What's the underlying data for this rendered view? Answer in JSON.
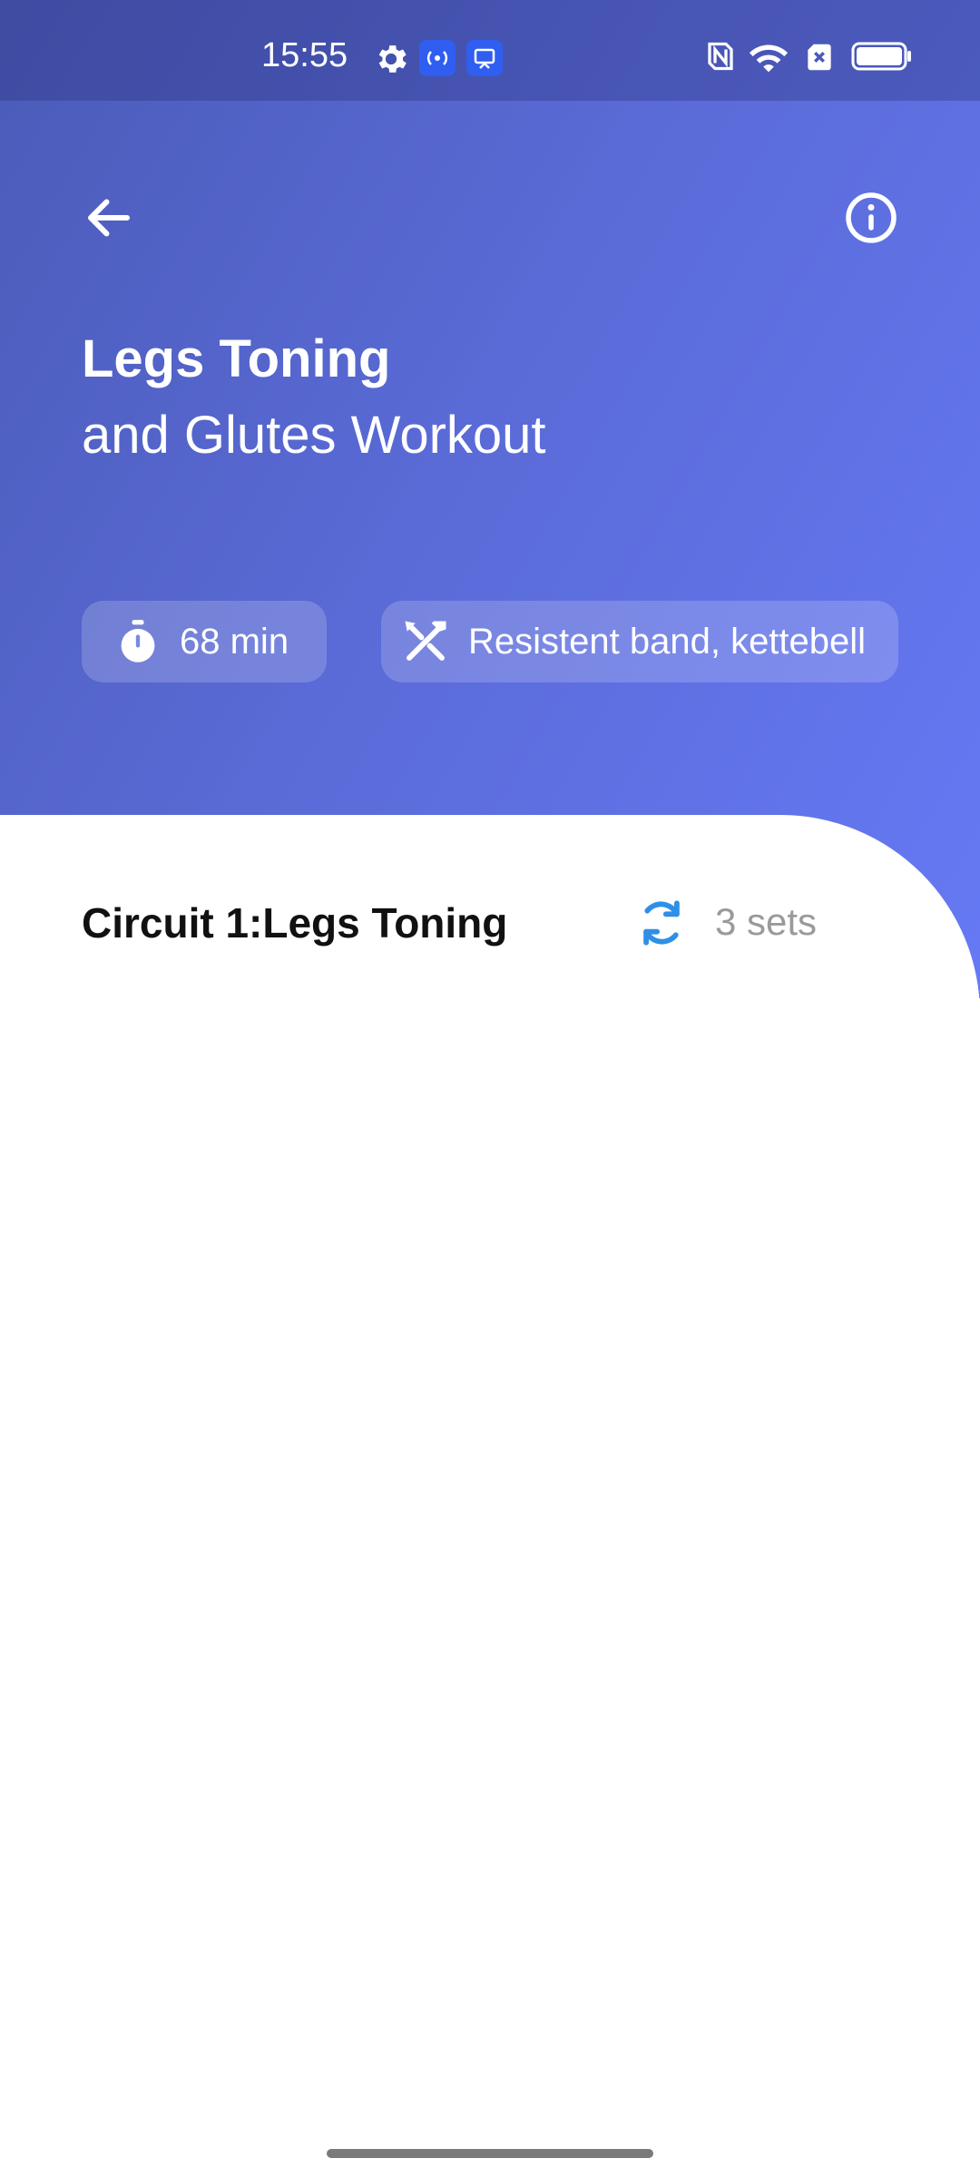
{
  "status_bar": {
    "time": "15:55",
    "left_icons": [
      "gear-icon",
      "hotspot-icon",
      "cast-icon"
    ],
    "right_icons": [
      "nfc-icon",
      "wifi-icon",
      "sim-off-icon",
      "battery-icon"
    ]
  },
  "header": {
    "back_icon": "arrow-left-icon",
    "info_icon": "info-icon",
    "title_line1": "Legs Toning",
    "title_line2": "and Glutes Workout"
  },
  "chips": {
    "duration": {
      "icon": "stopwatch-icon",
      "label": "68 min"
    },
    "equipment": {
      "icon": "tools-icon",
      "label": "Resistent band, kettebell"
    }
  },
  "circuit": {
    "title": "Circuit 1:Legs Toning",
    "sets_icon": "repeat-icon",
    "sets_label": "3 sets"
  },
  "colors": {
    "gradient_start": "#4a5bb8",
    "gradient_end": "#6679f5",
    "repeat_icon": "#2f8fe8",
    "sets_text": "#9a9a9a"
  }
}
